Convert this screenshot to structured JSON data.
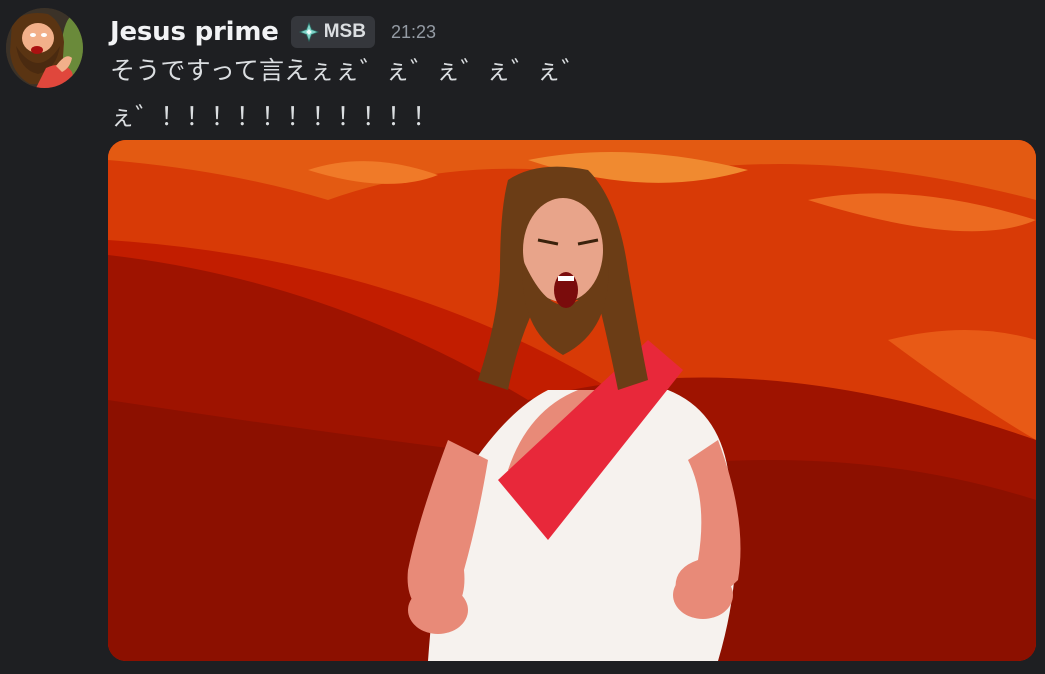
{
  "message": {
    "author": "Jesus prime",
    "tag": {
      "label": "MSB",
      "icon": "diamond-sparkle-icon",
      "icon_color": "#7fd3c8"
    },
    "timestamp": "21:23",
    "text": "そうですって言えぇぇ゛ぇ゛ぇ゛ぇ゛ぇ゛ぇ゛！！！！！！！！！！！"
  },
  "attachment": {
    "type": "image",
    "description_name": "animated-jesus-shouting-image"
  },
  "colors": {
    "background": "#1e1f22",
    "author": "#f2f3f5",
    "body_text": "#dbdee1",
    "timestamp": "#949ba4",
    "tag_bg": "#35373c"
  }
}
